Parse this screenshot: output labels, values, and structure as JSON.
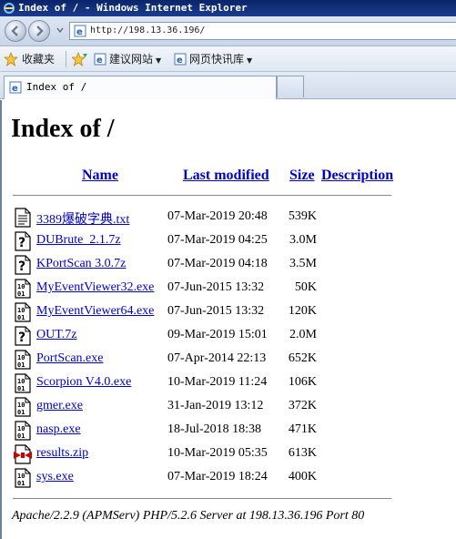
{
  "window": {
    "title": "Index of / - Windows Internet Explorer"
  },
  "address_bar": {
    "url": "http://198.13.36.196/"
  },
  "favorites_bar": {
    "favorites_label": "收藏夹",
    "suggested_sites_label": "建议网站",
    "web_slice_gallery_label": "网页快讯库"
  },
  "tabs": [
    {
      "label": "Index of /"
    }
  ],
  "page": {
    "heading": "Index of /",
    "columns": {
      "name": "Name",
      "last_modified": "Last modified",
      "size": "Size",
      "description": "Description"
    },
    "files": [
      {
        "name": "3389爆破字典.txt",
        "date": "07-Mar-2019 20:48",
        "size": "539K",
        "icon": "text-file-icon"
      },
      {
        "name": "DUBrute_2.1.7z",
        "date": "07-Mar-2019 04:25",
        "size": "3.0M",
        "icon": "unknown-file-icon"
      },
      {
        "name": "KPortScan 3.0.7z",
        "date": "07-Mar-2019 04:18",
        "size": "3.5M",
        "icon": "unknown-file-icon"
      },
      {
        "name": "MyEventViewer32.exe",
        "date": "07-Jun-2015 13:32",
        "size": "50K",
        "icon": "binary-file-icon"
      },
      {
        "name": "MyEventViewer64.exe",
        "date": "07-Jun-2015 13:32",
        "size": "120K",
        "icon": "binary-file-icon"
      },
      {
        "name": "OUT.7z",
        "date": "09-Mar-2019 15:01",
        "size": "2.0M",
        "icon": "unknown-file-icon"
      },
      {
        "name": "PortScan.exe",
        "date": "07-Apr-2014 22:13",
        "size": "652K",
        "icon": "binary-file-icon"
      },
      {
        "name": "Scorpion V4.0.exe",
        "date": "10-Mar-2019 11:24",
        "size": "106K",
        "icon": "binary-file-icon"
      },
      {
        "name": "gmer.exe",
        "date": "31-Jan-2019 13:12",
        "size": "372K",
        "icon": "binary-file-icon"
      },
      {
        "name": "nasp.exe",
        "date": "18-Jul-2018 18:38",
        "size": "471K",
        "icon": "binary-file-icon"
      },
      {
        "name": "results.zip",
        "date": "10-Mar-2019 05:35",
        "size": "613K",
        "icon": "compressed-file-icon"
      },
      {
        "name": "sys.exe",
        "date": "07-Mar-2019 18:24",
        "size": "400K",
        "icon": "binary-file-icon"
      }
    ],
    "footer": "Apache/2.2.9 (APMServ) PHP/5.2.6 Server at 198.13.36.196 Port 80"
  },
  "colors": {
    "link": "#0000cc",
    "title_bar": "#0a246a"
  }
}
